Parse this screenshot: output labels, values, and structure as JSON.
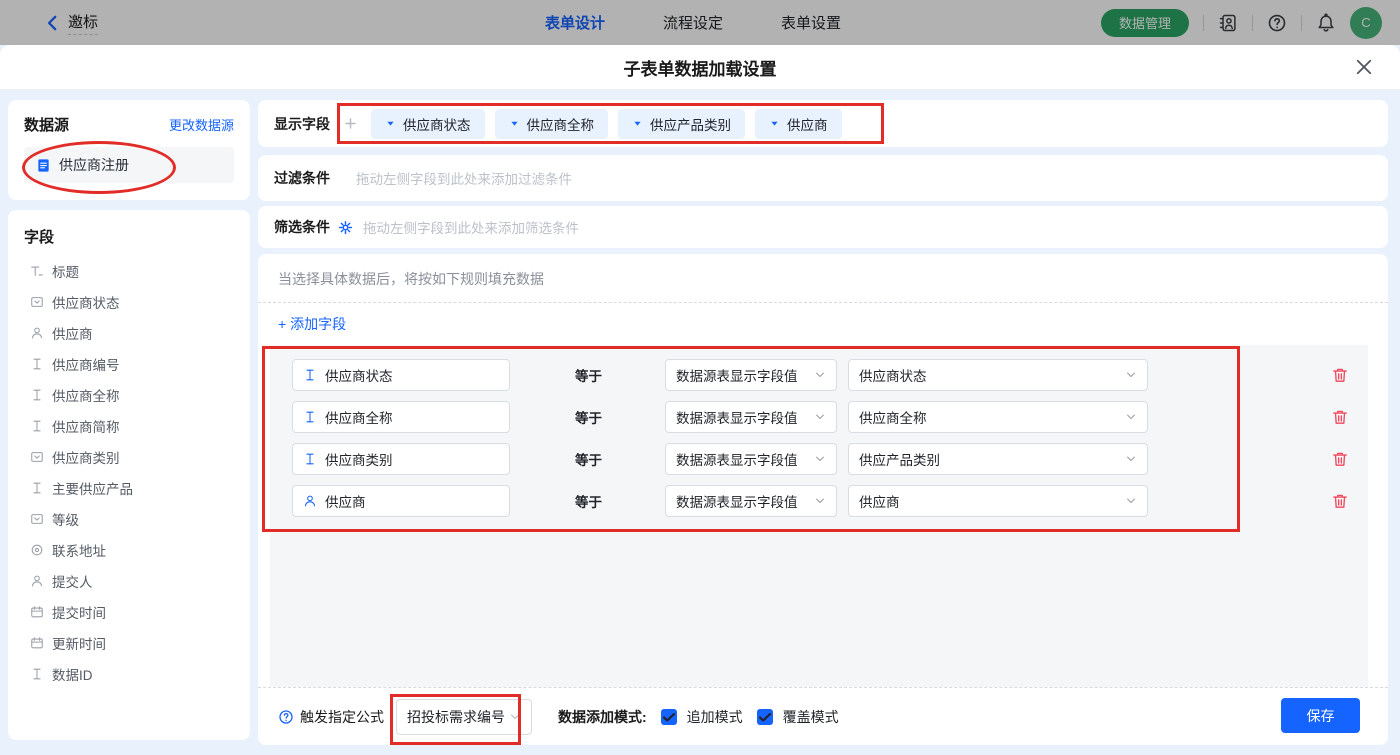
{
  "topbar": {
    "back_label": "邀标",
    "tabs": [
      {
        "label": "表单设计",
        "active": true
      },
      {
        "label": "流程设定",
        "active": false
      },
      {
        "label": "表单设置",
        "active": false
      }
    ],
    "data_manage_button": "数据管理",
    "avatar_initial": "C"
  },
  "modal": {
    "title": "子表单数据加载设置"
  },
  "datasource_panel": {
    "title": "数据源",
    "change_link": "更改数据源",
    "source_name": "供应商注册"
  },
  "fields_panel": {
    "title": "字段",
    "items": [
      {
        "icon": "title-icon",
        "label": "标题"
      },
      {
        "icon": "select-icon",
        "label": "供应商状态"
      },
      {
        "icon": "person-icon",
        "label": "供应商"
      },
      {
        "icon": "text-icon",
        "label": "供应商编号"
      },
      {
        "icon": "text-icon",
        "label": "供应商全称"
      },
      {
        "icon": "text-icon",
        "label": "供应商简称"
      },
      {
        "icon": "select-icon",
        "label": "供应商类别"
      },
      {
        "icon": "text-icon",
        "label": "主要供应产品"
      },
      {
        "icon": "select-icon",
        "label": "等级"
      },
      {
        "icon": "location-icon",
        "label": "联系地址"
      },
      {
        "icon": "person-icon",
        "label": "提交人"
      },
      {
        "icon": "calendar-icon",
        "label": "提交时间"
      },
      {
        "icon": "calendar-icon",
        "label": "更新时间"
      },
      {
        "icon": "text-icon",
        "label": "数据ID"
      }
    ]
  },
  "display_fields": {
    "label": "显示字段",
    "tags": [
      "供应商状态",
      "供应商全称",
      "供应产品类别",
      "供应商"
    ]
  },
  "filter_row": {
    "label": "过滤条件",
    "placeholder": "拖动左侧字段到此处来添加过滤条件"
  },
  "screen_row": {
    "label": "筛选条件",
    "placeholder": "拖动左侧字段到此处来添加筛选条件"
  },
  "rules": {
    "header": "当选择具体数据后，将按如下规则填充数据",
    "add_field_label": "+ 添加字段",
    "rows": [
      {
        "icon": "text-icon",
        "field": "供应商状态",
        "operator": "等于",
        "source": "数据源表显示字段值",
        "value": "供应商状态"
      },
      {
        "icon": "text-icon",
        "field": "供应商全称",
        "operator": "等于",
        "source": "数据源表显示字段值",
        "value": "供应商全称"
      },
      {
        "icon": "text-icon",
        "field": "供应商类别",
        "operator": "等于",
        "source": "数据源表显示字段值",
        "value": "供应产品类别"
      },
      {
        "icon": "person-icon",
        "field": "供应商",
        "operator": "等于",
        "source": "数据源表显示字段值",
        "value": "供应商"
      }
    ]
  },
  "footer": {
    "formula_label": "触发指定公式",
    "formula_value": "招投标需求编号",
    "mode_label": "数据添加模式:",
    "modes": [
      {
        "label": "追加模式",
        "checked": true
      },
      {
        "label": "覆盖模式",
        "checked": true
      }
    ],
    "save_button": "保存"
  },
  "colors": {
    "accent_blue": "#1664ff",
    "annotation_red": "#e22c28",
    "trash_red": "#f2475c",
    "green_button": "#2aa565",
    "avatar_green": "#45b37b",
    "body_bg": "#e9f2fc",
    "panel_gray": "#f5f6f8",
    "tag_bg": "#e8f1fe"
  }
}
